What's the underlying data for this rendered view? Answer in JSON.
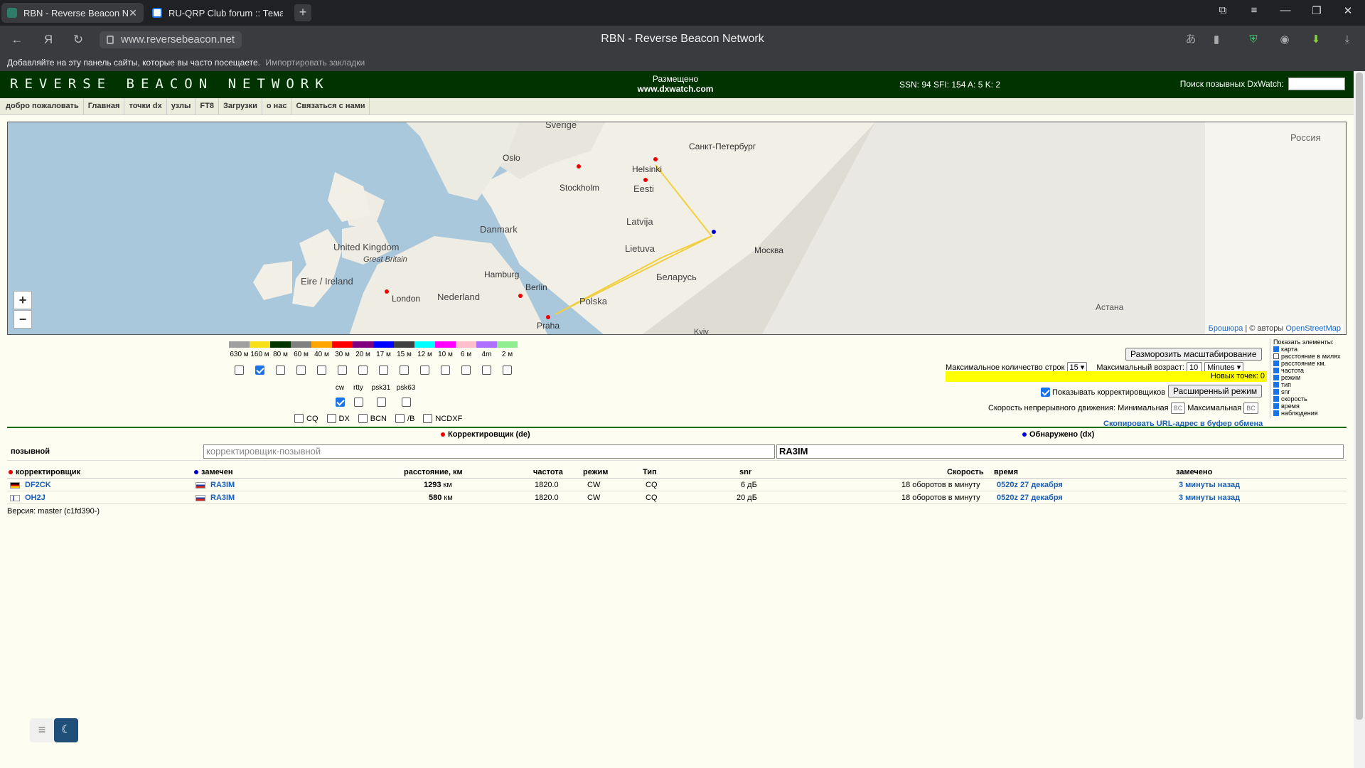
{
  "browser": {
    "tabs": [
      {
        "title": "RBN - Reverse Beacon N",
        "active": true
      },
      {
        "title": "RU-QRP Club forum :: Тема",
        "active": false
      }
    ],
    "url": "www.reversebeacon.net",
    "page_title": "RBN - Reverse Beacon Network",
    "bookmarks_hint": "Добавляйте на эту панель сайты, которые вы часто посещаете.",
    "bookmarks_import": "Импортировать закладки"
  },
  "header": {
    "logo": "REVERSE BEACON NETWORK",
    "hosted_label": "Размещено",
    "hosted_site": "www.dxwatch.com",
    "solar": "SSN: 94 SFI: 154 A: 5 K: 2",
    "dx_search_label": "Поиск позывных DxWatch:"
  },
  "menu": [
    "добро пожаловать",
    "Главная",
    "точки dx",
    "узлы",
    "FT8",
    "Загрузки",
    "о нас",
    "Связаться с нами"
  ],
  "map": {
    "labels": [
      "Sverige",
      "Oslo",
      "Stockholm",
      "Helsinki",
      "Санкт-Петербург",
      "Eesti",
      "Latvija",
      "Lietuva",
      "Danmark",
      "United Kingdom",
      "Great Britain",
      "Eire / Ireland",
      "London",
      "Nederland",
      "Hamburg",
      "Berlin",
      "Polska",
      "Беларусь",
      "Москва",
      "Praha",
      "Россия",
      "Астана",
      "Kyiv"
    ],
    "attribution_link": "Брошюра",
    "attribution_text": "| © авторы",
    "attribution_osm": "OpenStreetMap",
    "zoom_in": "+",
    "zoom_out": "−"
  },
  "bands": [
    {
      "label": "630 м",
      "color": "#a0a0a0",
      "checked": false
    },
    {
      "label": "160 м",
      "color": "#f7e017",
      "checked": true
    },
    {
      "label": "80 м",
      "color": "#003300",
      "checked": false
    },
    {
      "label": "60 м",
      "color": "#808080",
      "checked": false
    },
    {
      "label": "40 м",
      "color": "#ffa500",
      "checked": false
    },
    {
      "label": "30 м",
      "color": "#ff0000",
      "checked": false
    },
    {
      "label": "20 м",
      "color": "#800080",
      "checked": false
    },
    {
      "label": "17 м",
      "color": "#0000ff",
      "checked": false
    },
    {
      "label": "15 м",
      "color": "#404040",
      "checked": false
    },
    {
      "label": "12 м",
      "color": "#00ffff",
      "checked": false
    },
    {
      "label": "10 м",
      "color": "#ff00ff",
      "checked": false
    },
    {
      "label": "6 м",
      "color": "#ffc0cb",
      "checked": false
    },
    {
      "label": "4m",
      "color": "#b070ff",
      "checked": false
    },
    {
      "label": "2 м",
      "color": "#90ee90",
      "checked": false
    }
  ],
  "modes": [
    {
      "label": "cw",
      "checked": true
    },
    {
      "label": "rtty",
      "checked": false
    },
    {
      "label": "psk31",
      "checked": false
    },
    {
      "label": "psk63",
      "checked": false
    }
  ],
  "types": [
    "CQ",
    "DX",
    "BCN",
    "/B",
    "NCDXF"
  ],
  "controls": {
    "unfreeze_button": "Разморозить масштабирование",
    "max_rows_label": "Максимальное количество строк",
    "max_rows_value": "15",
    "max_age_label": "Максимальный возраст:",
    "max_age_value": "10",
    "max_age_unit": "Minutes",
    "new_points": "Новых точек: 0",
    "show_skimmers": "Показывать корректировщиков",
    "advanced_button": "Расширенный режим",
    "speed_label": "Скорость непрерывного движения: Минимальная",
    "speed_min": "BC",
    "speed_max_label": "Максимальная",
    "speed_max": "BC",
    "copy_url": "Скопировать URL-адрес в буфер обмена"
  },
  "show_panel": {
    "title": "Показать элементы:",
    "items": [
      {
        "label": "карта",
        "checked": true
      },
      {
        "label": "расстояние в милях",
        "checked": false
      },
      {
        "label": "расстояние км.",
        "checked": true
      },
      {
        "label": "частота",
        "checked": true
      },
      {
        "label": "режим",
        "checked": true
      },
      {
        "label": "тип",
        "checked": true
      },
      {
        "label": "snr",
        "checked": true
      },
      {
        "label": "скорость",
        "checked": true
      },
      {
        "label": "время",
        "checked": true
      },
      {
        "label": "наблюдения",
        "checked": true
      }
    ]
  },
  "filter": {
    "de_legend": "Корректировщик (de)",
    "dx_legend": "Обнаружено (dx)",
    "callsign_label": "позывной",
    "de_placeholder": "корректировщик-позывной",
    "dx_value": "RA3IM"
  },
  "table": {
    "headers": {
      "spotter": "корректировщик",
      "spotted": "замечен",
      "distance": "расстояние, км",
      "freq": "частота",
      "mode": "режим",
      "type": "Тип",
      "snr": "snr",
      "speed": "Скорость",
      "time": "время",
      "seen": "замечено"
    },
    "rows": [
      {
        "spotter": "DF2CK",
        "spotted": "RA3IM",
        "distance": "1293",
        "unit": "км",
        "freq": "1820.0",
        "mode": "CW",
        "type": "CQ",
        "snr": "6 дБ",
        "speed": "18 оборотов в минуту",
        "time": "0520z 27 декабря",
        "seen": "3 минуты назад"
      },
      {
        "spotter": "OH2J",
        "spotted": "RA3IM",
        "distance": "580",
        "unit": "км",
        "freq": "1820.0",
        "mode": "CW",
        "type": "CQ",
        "snr": "20 дБ",
        "speed": "18 оборотов в минуту",
        "time": "0520z 27 декабря",
        "seen": "3 минуты назад"
      }
    ]
  },
  "version": "Версия: master (c1fd390-)"
}
